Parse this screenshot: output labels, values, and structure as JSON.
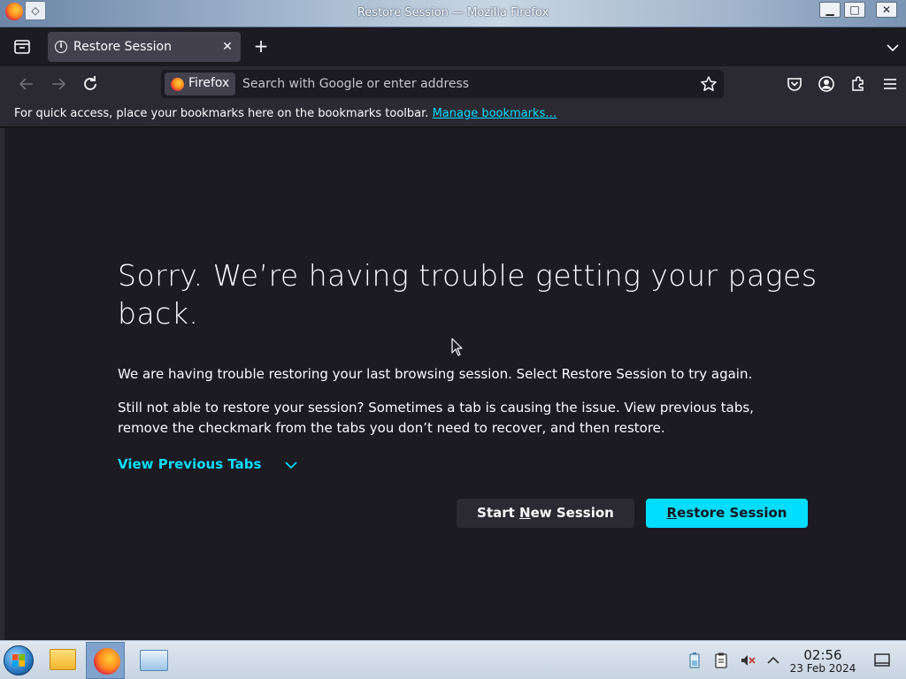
{
  "window": {
    "title": "Restore Session — Mozilla Firefox"
  },
  "tabs": {
    "active_title": "Restore Session"
  },
  "navbar": {
    "identity_label": "Firefox",
    "url_placeholder": "Search with Google or enter address"
  },
  "bookmarks_bar": {
    "message": "For quick access, place your bookmarks here on the bookmarks toolbar.",
    "manage_link": "Manage bookmarks…"
  },
  "content": {
    "title": "Sorry. We’re having trouble getting your pages back.",
    "description_1": "We are having trouble restoring your last browsing session. Select Restore Session to try again.",
    "description_2": "Still not able to restore your session? Sometimes a tab is causing the issue. View previous tabs, remove the checkmark from the tabs you don’t need to recover, and then restore.",
    "view_previous_tabs": "View Previous Tabs",
    "start_new_pre": "Start ",
    "start_new_ul": "N",
    "start_new_post": "ew Session",
    "restore_ul": "R",
    "restore_post": "estore Session"
  },
  "taskbar": {
    "clock_time": "02:56",
    "clock_date": "23 Feb 2024"
  },
  "colors": {
    "accent": "#00ddff",
    "background": "#1c1b22",
    "toolbar": "#2b2a33"
  }
}
